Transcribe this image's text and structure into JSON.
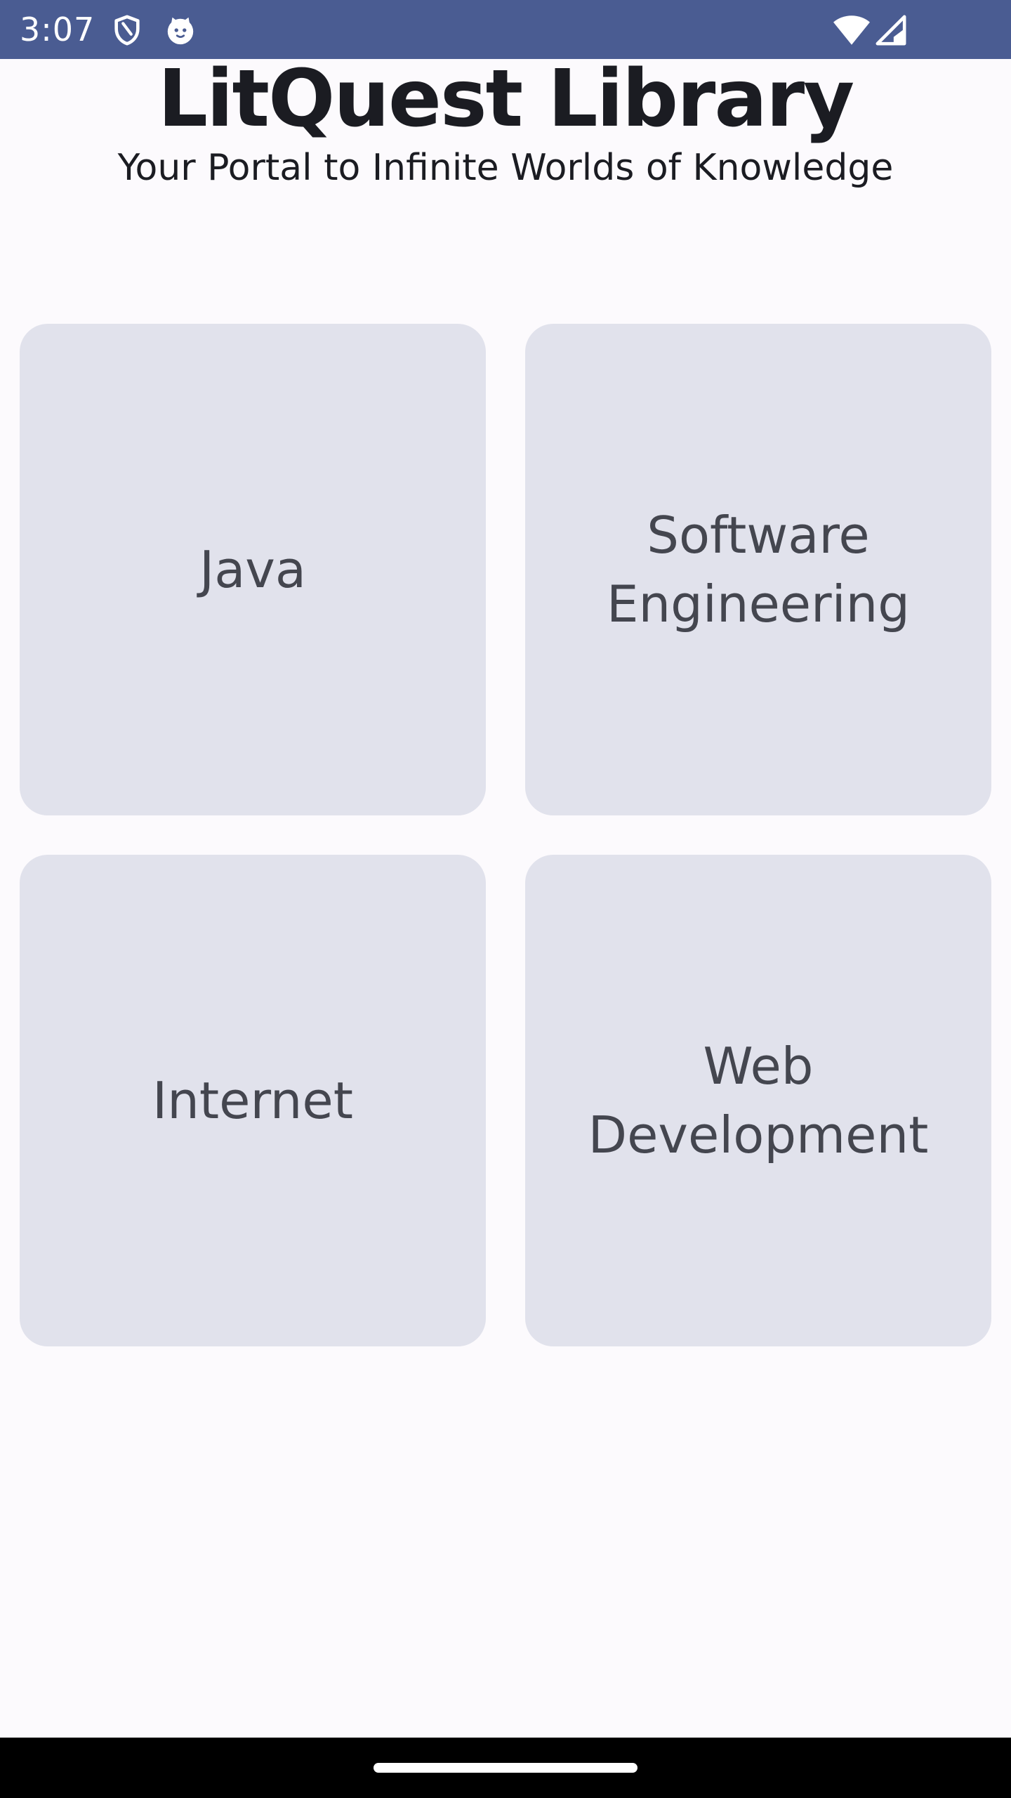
{
  "status_bar": {
    "time": "3:07",
    "background_color": "#4a5c92",
    "left_icons": [
      "shield-icon",
      "cat-face-icon"
    ],
    "right_icons": [
      "wifi-icon",
      "cellular-signal-icon"
    ]
  },
  "header": {
    "title": "LitQuest Library",
    "subtitle": "Your Portal to Infinite Worlds of Knowledge"
  },
  "categories": [
    {
      "label": "Java"
    },
    {
      "label": "Software\nEngineering"
    },
    {
      "label": "Internet"
    },
    {
      "label": "Web\nDevelopment"
    }
  ],
  "colors": {
    "background": "#fcfafd",
    "card": "#e1e2ec",
    "card_text": "#44464f",
    "title_text": "#1b1c22"
  }
}
